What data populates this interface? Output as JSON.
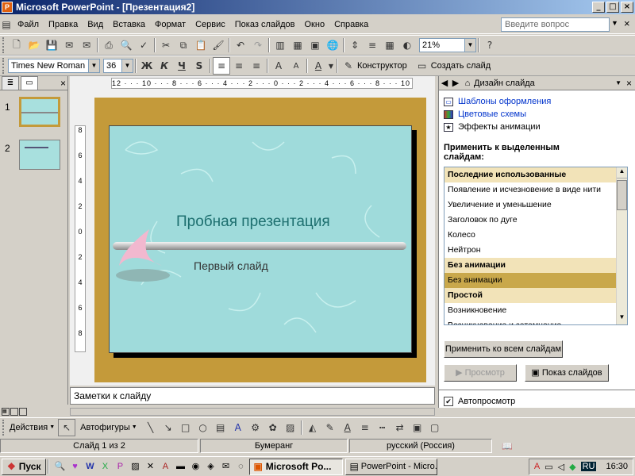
{
  "window": {
    "title": "Microsoft PowerPoint - [Презентация2]"
  },
  "menu": {
    "items": [
      "Файл",
      "Правка",
      "Вид",
      "Вставка",
      "Формат",
      "Сервис",
      "Показ слайдов",
      "Окно",
      "Справка"
    ],
    "ask_placeholder": "Введите вопрос"
  },
  "standard_toolbar": {
    "zoom": "21%"
  },
  "format_toolbar": {
    "font": "Times New Roman",
    "size": "36",
    "bold": "Ж",
    "italic": "К",
    "underline": "Ч",
    "shadow": "S",
    "designer_label": "Конструктор",
    "new_slide_label": "Создать слайд"
  },
  "left_panel": {
    "thumbs": [
      "1",
      "2"
    ]
  },
  "slide": {
    "title": "Пробная презентация",
    "subtitle": "Первый слайд"
  },
  "rulers": {
    "h": "12 · · · 10 · · · 8 · · · 6 · · · 4 · · · 2 · · · 0 · · · 2 · · · 4 · · · 6 · · · 8 · · · 10 · · · 12",
    "v": [
      "8",
      "6",
      "4",
      "2",
      "0",
      "2",
      "4",
      "6",
      "8"
    ]
  },
  "notes": {
    "placeholder": "Заметки к слайду"
  },
  "task_pane": {
    "title": "Дизайн слайда",
    "links": [
      "Шаблоны оформления",
      "Цветовые схемы",
      "Эффекты анимации"
    ],
    "apply_label": "Применить к выделенным слайдам:",
    "list": [
      {
        "text": "Последние использованные",
        "type": "group"
      },
      {
        "text": "Появление и исчезновение в виде нити",
        "type": "item"
      },
      {
        "text": "Увеличение и уменьшение",
        "type": "item"
      },
      {
        "text": "Заголовок по дуге",
        "type": "item"
      },
      {
        "text": "Колесо",
        "type": "item"
      },
      {
        "text": "Нейтрон",
        "type": "item"
      },
      {
        "text": "Без анимации",
        "type": "group"
      },
      {
        "text": "Без анимации",
        "type": "sel"
      },
      {
        "text": "Простой",
        "type": "group"
      },
      {
        "text": "Возникновение",
        "type": "item"
      },
      {
        "text": "Возникновение и затемнение",
        "type": "item"
      }
    ],
    "apply_all": "Применить ко всем слайдам",
    "preview": "Просмотр",
    "slideshow": "Показ слайдов",
    "autopreview": "Автопросмотр"
  },
  "drawing_toolbar": {
    "actions": "Действия",
    "autoshapes": "Автофигуры"
  },
  "status": {
    "slide": "Слайд 1 из 2",
    "design": "Бумеранг",
    "lang": "русский (Россия)"
  },
  "taskbar": {
    "start": "Пуск",
    "tasks": [
      "Microsoft Po...",
      "PowerPoint - Micro..."
    ],
    "lang": "RU",
    "time": "16:30"
  },
  "colors": {
    "slide_bg": "#9fdbdb",
    "frame": "#c49a3a",
    "title": "#1d6f6f",
    "link": "#0033cc"
  }
}
